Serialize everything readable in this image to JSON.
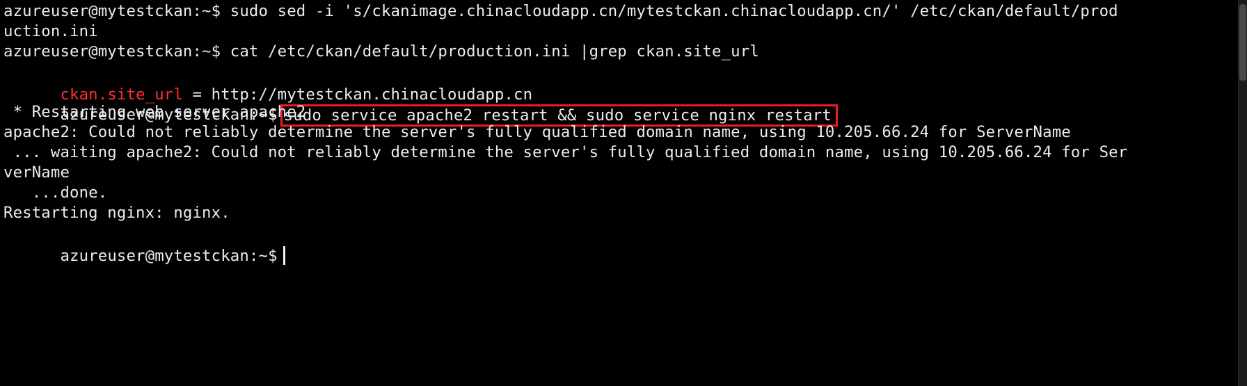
{
  "terminal": {
    "lines": [
      "azureuser@mytestckan:~$ sudo sed -i 's/ckanimage.chinacloudapp.cn/mytestckan.chinacloudapp.cn/' /etc/ckan/default/prod",
      "uction.ini",
      "azureuser@mytestckan:~$ cat /etc/ckan/default/production.ini |grep ckan.site_url",
      {
        "red": "ckan.site_url",
        "rest": " = http://mytestckan.chinacloudapp.cn"
      },
      {
        "prompt": "azureuser@mytestckan:~$",
        "command": "sudo service apache2 restart && sudo service nginx restart"
      },
      " * Restarting web server apache2",
      "apache2: Could not reliably determine the server's fully qualified domain name, using 10.205.66.24 for ServerName",
      " ... waiting apache2: Could not reliably determine the server's fully qualified domain name, using 10.205.66.24 for Ser",
      "verName",
      "   ...done.",
      "Restarting nginx: nginx.",
      {
        "prompt": "azureuser@mytestckan:~$",
        "cursor": true
      }
    ]
  }
}
